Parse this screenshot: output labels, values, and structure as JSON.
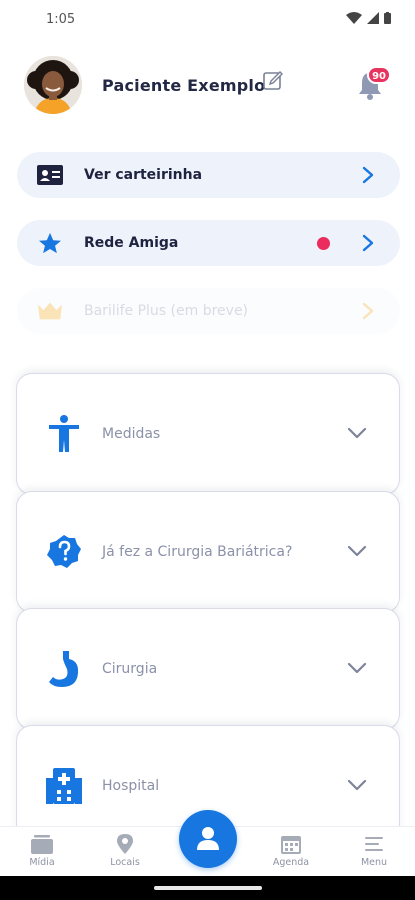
{
  "status_bar": {
    "time": "1:05"
  },
  "profile": {
    "name": "Paciente Exemplo",
    "notifications_badge": "90"
  },
  "quick_links": [
    {
      "label": "Ver carteirinha",
      "icon": "id-card-icon"
    },
    {
      "label": "Rede Amiga",
      "icon": "star-icon",
      "indicator_color": "#ea2d5c"
    },
    {
      "label": "Barilife Plus (em breve)",
      "icon": "crown-icon",
      "disabled": true
    }
  ],
  "sections": [
    {
      "label": "Medidas",
      "icon": "body-icon"
    },
    {
      "label": "Já fez a Cirurgia Bariátrica?",
      "icon": "question-badge-icon"
    },
    {
      "label": "Cirurgia",
      "icon": "stomach-icon"
    },
    {
      "label": "Hospital",
      "icon": "hospital-icon"
    }
  ],
  "bottom_nav": {
    "items": [
      {
        "label": "Mídia",
        "icon": "media-icon"
      },
      {
        "label": "Locais",
        "icon": "location-pin-icon"
      },
      {
        "label": "Agenda",
        "icon": "calendar-icon"
      },
      {
        "label": "Menu",
        "icon": "menu-icon"
      }
    ],
    "center_icon": "user-icon"
  },
  "colors": {
    "accent": "#1776e0",
    "badge": "#e8335e",
    "pill_bg": "#eef3fb",
    "muted_text": "#8b91a8",
    "crown": "#f5c46a"
  }
}
